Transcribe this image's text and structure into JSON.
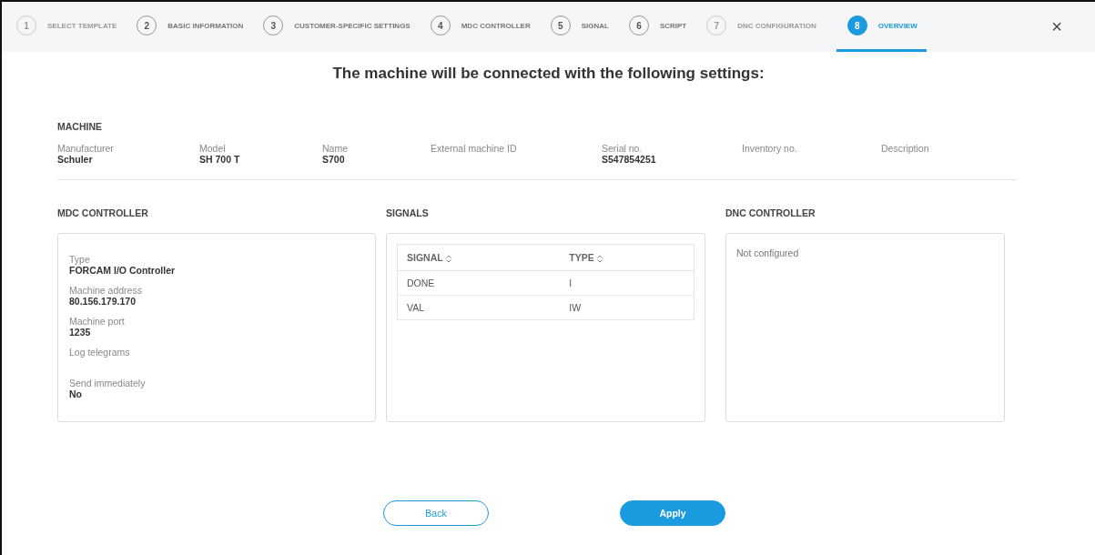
{
  "steps": [
    {
      "number": "1",
      "label": "SELECT TEMPLATE",
      "disabled": true,
      "selected": false
    },
    {
      "number": "2",
      "label": "BASIC INFORMATION",
      "disabled": false,
      "selected": false
    },
    {
      "number": "3",
      "label": "CUSTOMER-SPECIFIC SETTINGS",
      "disabled": false,
      "selected": false
    },
    {
      "number": "4",
      "label": "MDC CONTROLLER",
      "disabled": false,
      "selected": false
    },
    {
      "number": "5",
      "label": "SIGNAL",
      "disabled": false,
      "selected": false
    },
    {
      "number": "6",
      "label": "SCRIPT",
      "disabled": false,
      "selected": false
    },
    {
      "number": "7",
      "label": "DNC CONFIGURATION",
      "disabled": true,
      "selected": false
    },
    {
      "number": "8",
      "label": "OVERVIEW",
      "disabled": false,
      "selected": true
    }
  ],
  "close": "×",
  "heading": "The machine will be connected with the following settings:",
  "machine": {
    "title": "MACHINE",
    "fields": [
      {
        "label": "Manufacturer",
        "value": "Schuler"
      },
      {
        "label": "Model",
        "value": "SH 700 T"
      },
      {
        "label": "Name",
        "value": "S700"
      },
      {
        "label": "External machine ID"
      },
      {
        "label": "Serial no.",
        "value": "S547854251"
      },
      {
        "label": "Inventory no."
      },
      {
        "label": "Description"
      }
    ]
  },
  "mdc_controller": {
    "title": "MDC CONTROLLER",
    "fields": [
      {
        "label": "Type",
        "value": "FORCAM I/O Controller"
      },
      {
        "label": "Machine address",
        "value": "80.156.179.170"
      },
      {
        "label": "Machine port",
        "value": "1235"
      },
      {
        "label": "Log telegrams"
      },
      {
        "label": "Send immediately",
        "value": "No"
      }
    ]
  },
  "signals": {
    "title": "SIGNALS",
    "columns": [
      "SIGNAL",
      "TYPE"
    ],
    "rows": [
      [
        "DONE",
        "I"
      ],
      [
        "VAL",
        "IW"
      ]
    ]
  },
  "dnc_controller": {
    "title": "DNC CONTROLLER",
    "message": "Not configured"
  },
  "buttons": [
    {
      "label": "Back",
      "kind": "secondary"
    },
    {
      "label": "Apply",
      "kind": "primary"
    }
  ]
}
